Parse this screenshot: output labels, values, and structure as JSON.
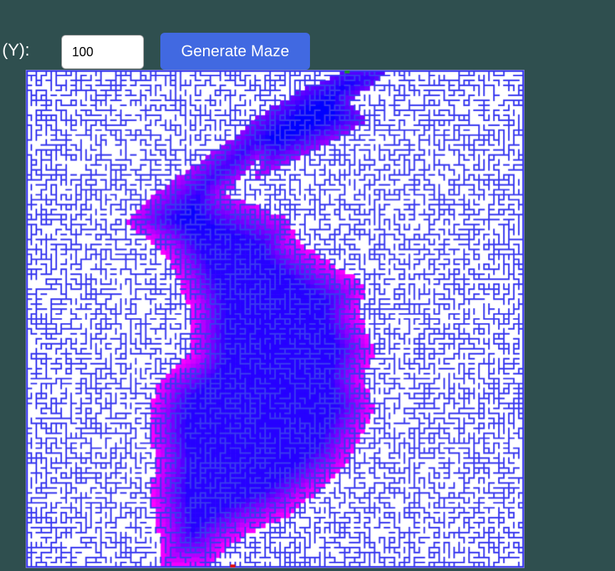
{
  "controls": {
    "height_label": "ght (Y):",
    "height_value": "100",
    "generate_label": "Generate Maze"
  },
  "maze": {
    "rows": 100,
    "wall_color": "#3a3af0",
    "floor_color": "#ffffff",
    "near_color": "#0000ff",
    "far_color": "#ff00ff",
    "start_color": "#1f8f2f",
    "end_color": "#e01010"
  },
  "colors": {
    "page_background": "#2f4f4f",
    "button_background": "#4169e1"
  }
}
